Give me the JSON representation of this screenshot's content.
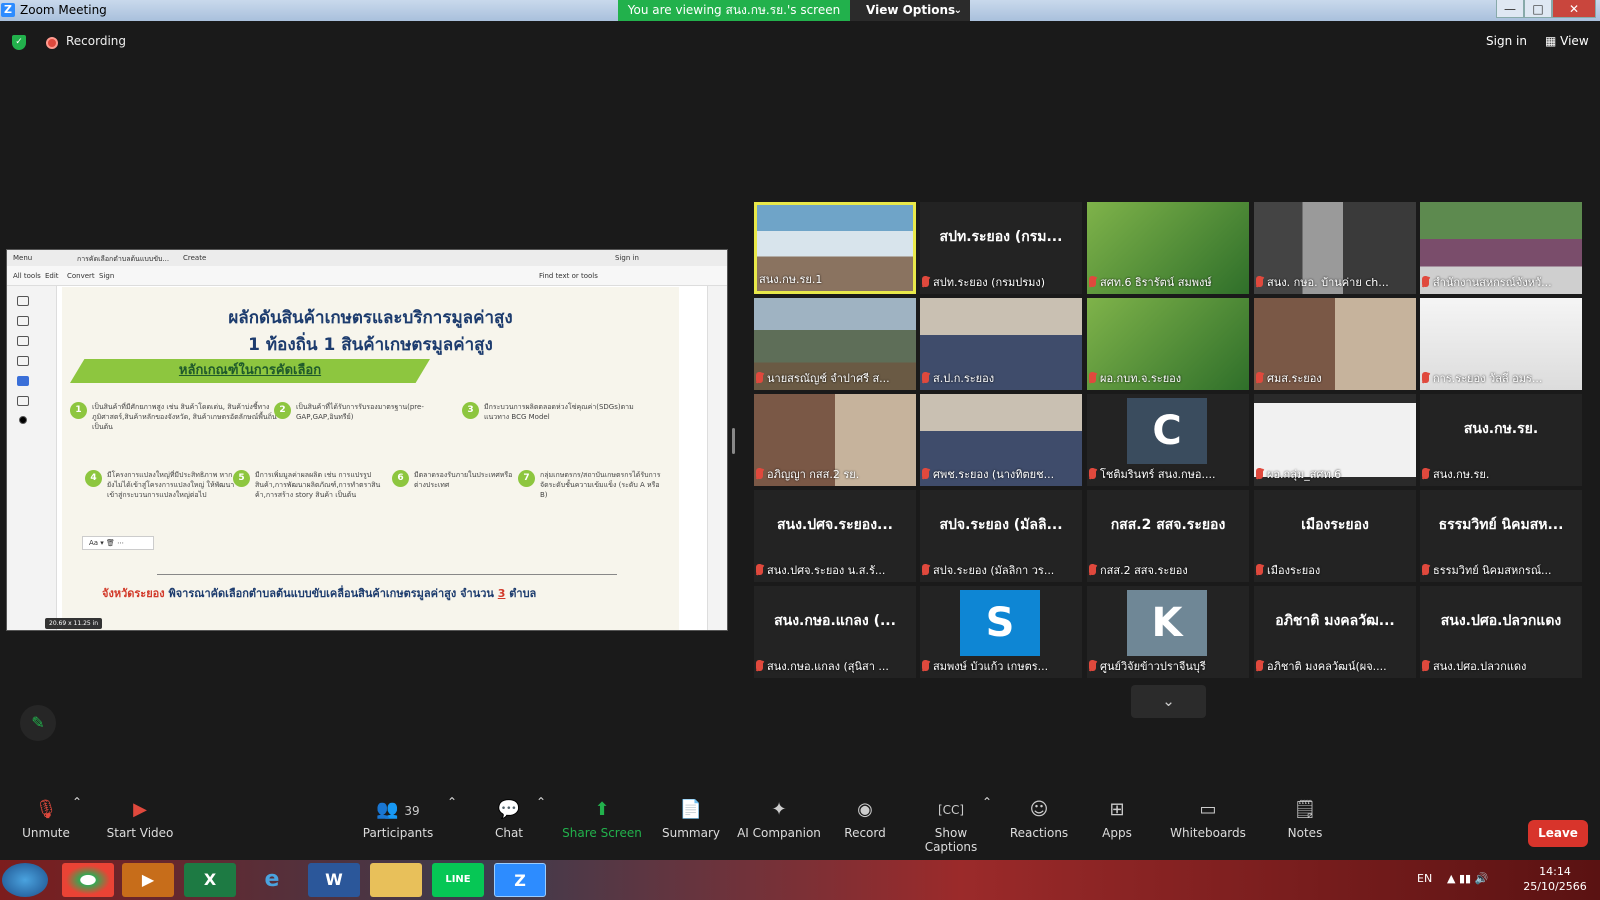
{
  "window": {
    "title": "Zoom Meeting",
    "viewing_banner": "You are viewing สนง.กษ.รย.'s screen",
    "view_options": "View Options",
    "minimize": "—",
    "maximize": "□",
    "close": "✕"
  },
  "status": {
    "recording": "Recording",
    "sign_in": "Sign in",
    "view": "View"
  },
  "shared_app": {
    "menu": "Menu",
    "tab_title": "การคัดเลือกตำบลต้นแบบขับ...",
    "create": "Create",
    "sign_in": "Sign in",
    "toolbar": [
      "All tools",
      "Edit",
      "Convert",
      "Sign"
    ],
    "find": "Find text or tools",
    "page_badge": "20.69 x 11.25 in",
    "mini_text": "Aa",
    "slide": {
      "title_line1": "ผลักดันสินค้าเกษตรและบริการมูลค่าสูง",
      "title_line2": "1 ท้องถิ่น 1 สินค้าเกษตรมูลค่าสูง",
      "criteria_heading": "หลักเกณฑ์ในการคัดเลือก",
      "items": [
        {
          "num": "1",
          "text": "เป็นสินค้าที่มีศักยภาพสูง เช่น สินค้าโดดเด่น, สินค้าบ่งชี้ทางภูมิศาสตร์,สินค้าหลักของจังหวัด, สินค้าเกษตรอัตลักษณ์พื้นถิ่น เป็นต้น"
        },
        {
          "num": "2",
          "text": "เป็นสินค้าที่ได้รับการรับรองมาตรฐาน(pre-GAP,GAP,อินทรีย์)"
        },
        {
          "num": "3",
          "text": "มีกระบวนการผลิตตลอดห่วงโซ่คุณค่า(SDGs)ตามแนวทาง BCG Model"
        },
        {
          "num": "4",
          "text": "มีโครงการแปลงใหญ่ที่มีประสิทธิภาพ หากยังไม่ได้เข้าสู่โครงการแปลงใหญ่ ให้พัฒนาเข้าสู่กระบวนการแปลงใหญ่ต่อไป"
        },
        {
          "num": "5",
          "text": "มีการเพิ่มมูลค่าผลผลิต เช่น การแปรรูปสินค้า,การพัฒนาผลิตภัณฑ์,การทำตราสินค้า,การสร้าง story สินค้า เป็นต้น"
        },
        {
          "num": "6",
          "text": "มีตลาดรองรับภายในประเทศหรือต่างประเทศ"
        },
        {
          "num": "7",
          "text": "กลุ่มเกษตรกร/สถาบันเกษตรกรได้รับการจัดระดับชั้นความเข้มแข็ง (ระดับ A หรือ B)"
        }
      ],
      "footer_province": "จังหวัดระยอง",
      "footer_text": " พิจารณาคัดเลือกตำบลต้นแบบขับเคลื่อนสินค้าเกษตรมูลค่าสูง จำนวน ",
      "footer_count": "3",
      "footer_unit": " ตำบล"
    }
  },
  "participants": [
    {
      "label": "สนง.กษ.รย.1",
      "type": "video",
      "scene": "conference",
      "active": true
    },
    {
      "label": "สปท.ระยอง (กรมปรมง)",
      "center": "สปท.ระยอง (กรม...",
      "type": "name"
    },
    {
      "label": "สศท.6 ธิรารัตน์ สมพงษ์",
      "type": "video",
      "scene": "green"
    },
    {
      "label": "สนง. กษอ. บ้านค่าย ch...",
      "type": "video",
      "scene": "gray"
    },
    {
      "label": "สำนักงานสหกรณ์จังหวั...",
      "type": "video",
      "scene": "woman"
    },
    {
      "label": "นายสรณัญช์ จำปาศรี ส...",
      "type": "video",
      "scene": "outdoor"
    },
    {
      "label": "ส.ป.ก.ระยอง",
      "type": "video",
      "scene": "office"
    },
    {
      "label": "ผอ.กบท.จ.ระยอง",
      "type": "video",
      "scene": "green"
    },
    {
      "label": "ศมส.ระยอง",
      "type": "video",
      "scene": "room"
    },
    {
      "label": "การ.ระยอง วัลลี่ อมร...",
      "type": "video",
      "scene": "white"
    },
    {
      "label": "อภิญญา กสส.2 รย.",
      "type": "video",
      "scene": "room"
    },
    {
      "label": "ศพช.ระยอง (นางทิตยช...",
      "type": "video",
      "scene": "office"
    },
    {
      "label": "โชติมรินทร์ สนง.กษอ....",
      "type": "avatar",
      "letter": "C",
      "color": "#3a4c5e"
    },
    {
      "label": "ผอ.กลุ่ม_สศท.6",
      "type": "video",
      "scene": "photo"
    },
    {
      "label": "สนง.กษ.รย.",
      "center": "สนง.กษ.รย.",
      "type": "name"
    },
    {
      "label": "สนง.ปศจ.ระยอง น.ส.รั...",
      "center": "สนง.ปศจ.ระยอง...",
      "type": "name"
    },
    {
      "label": "สปจ.ระยอง (มัลลิกา วร...",
      "center": "สปจ.ระยอง (มัลลิ...",
      "type": "name"
    },
    {
      "label": "กสส.2 สสจ.ระยอง",
      "center": "กสส.2 สสจ.ระยอง",
      "type": "name"
    },
    {
      "label": "เมืองระยอง",
      "center": "เมืองระยอง",
      "type": "name"
    },
    {
      "label": "ธรรมวิทย์ นิคมสหกรณ์...",
      "center": "ธรรมวิทย์ นิคมสห...",
      "type": "name"
    },
    {
      "label": "สนง.กษอ.แกลง (สุนิสา ...",
      "center": "สนง.กษอ.แกลง (...",
      "type": "name"
    },
    {
      "label": "สมพงษ์ บัวแก้ว เกษตร...",
      "type": "avatar",
      "letter": "S",
      "color": "#0e86d4"
    },
    {
      "label": "ศูนย์วิจัยข้าวปราจีนบุรี",
      "type": "avatar",
      "letter": "K",
      "color": "#6f8796"
    },
    {
      "label": "อภิชาติ มงคลวัฒน์(ผจ....",
      "center": "อภิชาติ มงคลวัฒ...",
      "type": "name"
    },
    {
      "label": "สนง.ปศอ.ปลวกแดง",
      "center": "สนง.ปศอ.ปลวกแดง",
      "type": "name"
    }
  ],
  "toolbar": {
    "unmute": "Unmute",
    "start_video": "Start Video",
    "participants": "Participants",
    "participants_count": "39",
    "chat": "Chat",
    "share_screen": "Share Screen",
    "summary": "Summary",
    "ai_companion": "AI Companion",
    "record": "Record",
    "show_captions": "Show Captions",
    "reactions": "Reactions",
    "apps": "Apps",
    "whiteboards": "Whiteboards",
    "notes": "Notes",
    "leave": "Leave"
  },
  "taskbar": {
    "lang": "EN",
    "time": "14:14",
    "date": "25/10/2566"
  }
}
